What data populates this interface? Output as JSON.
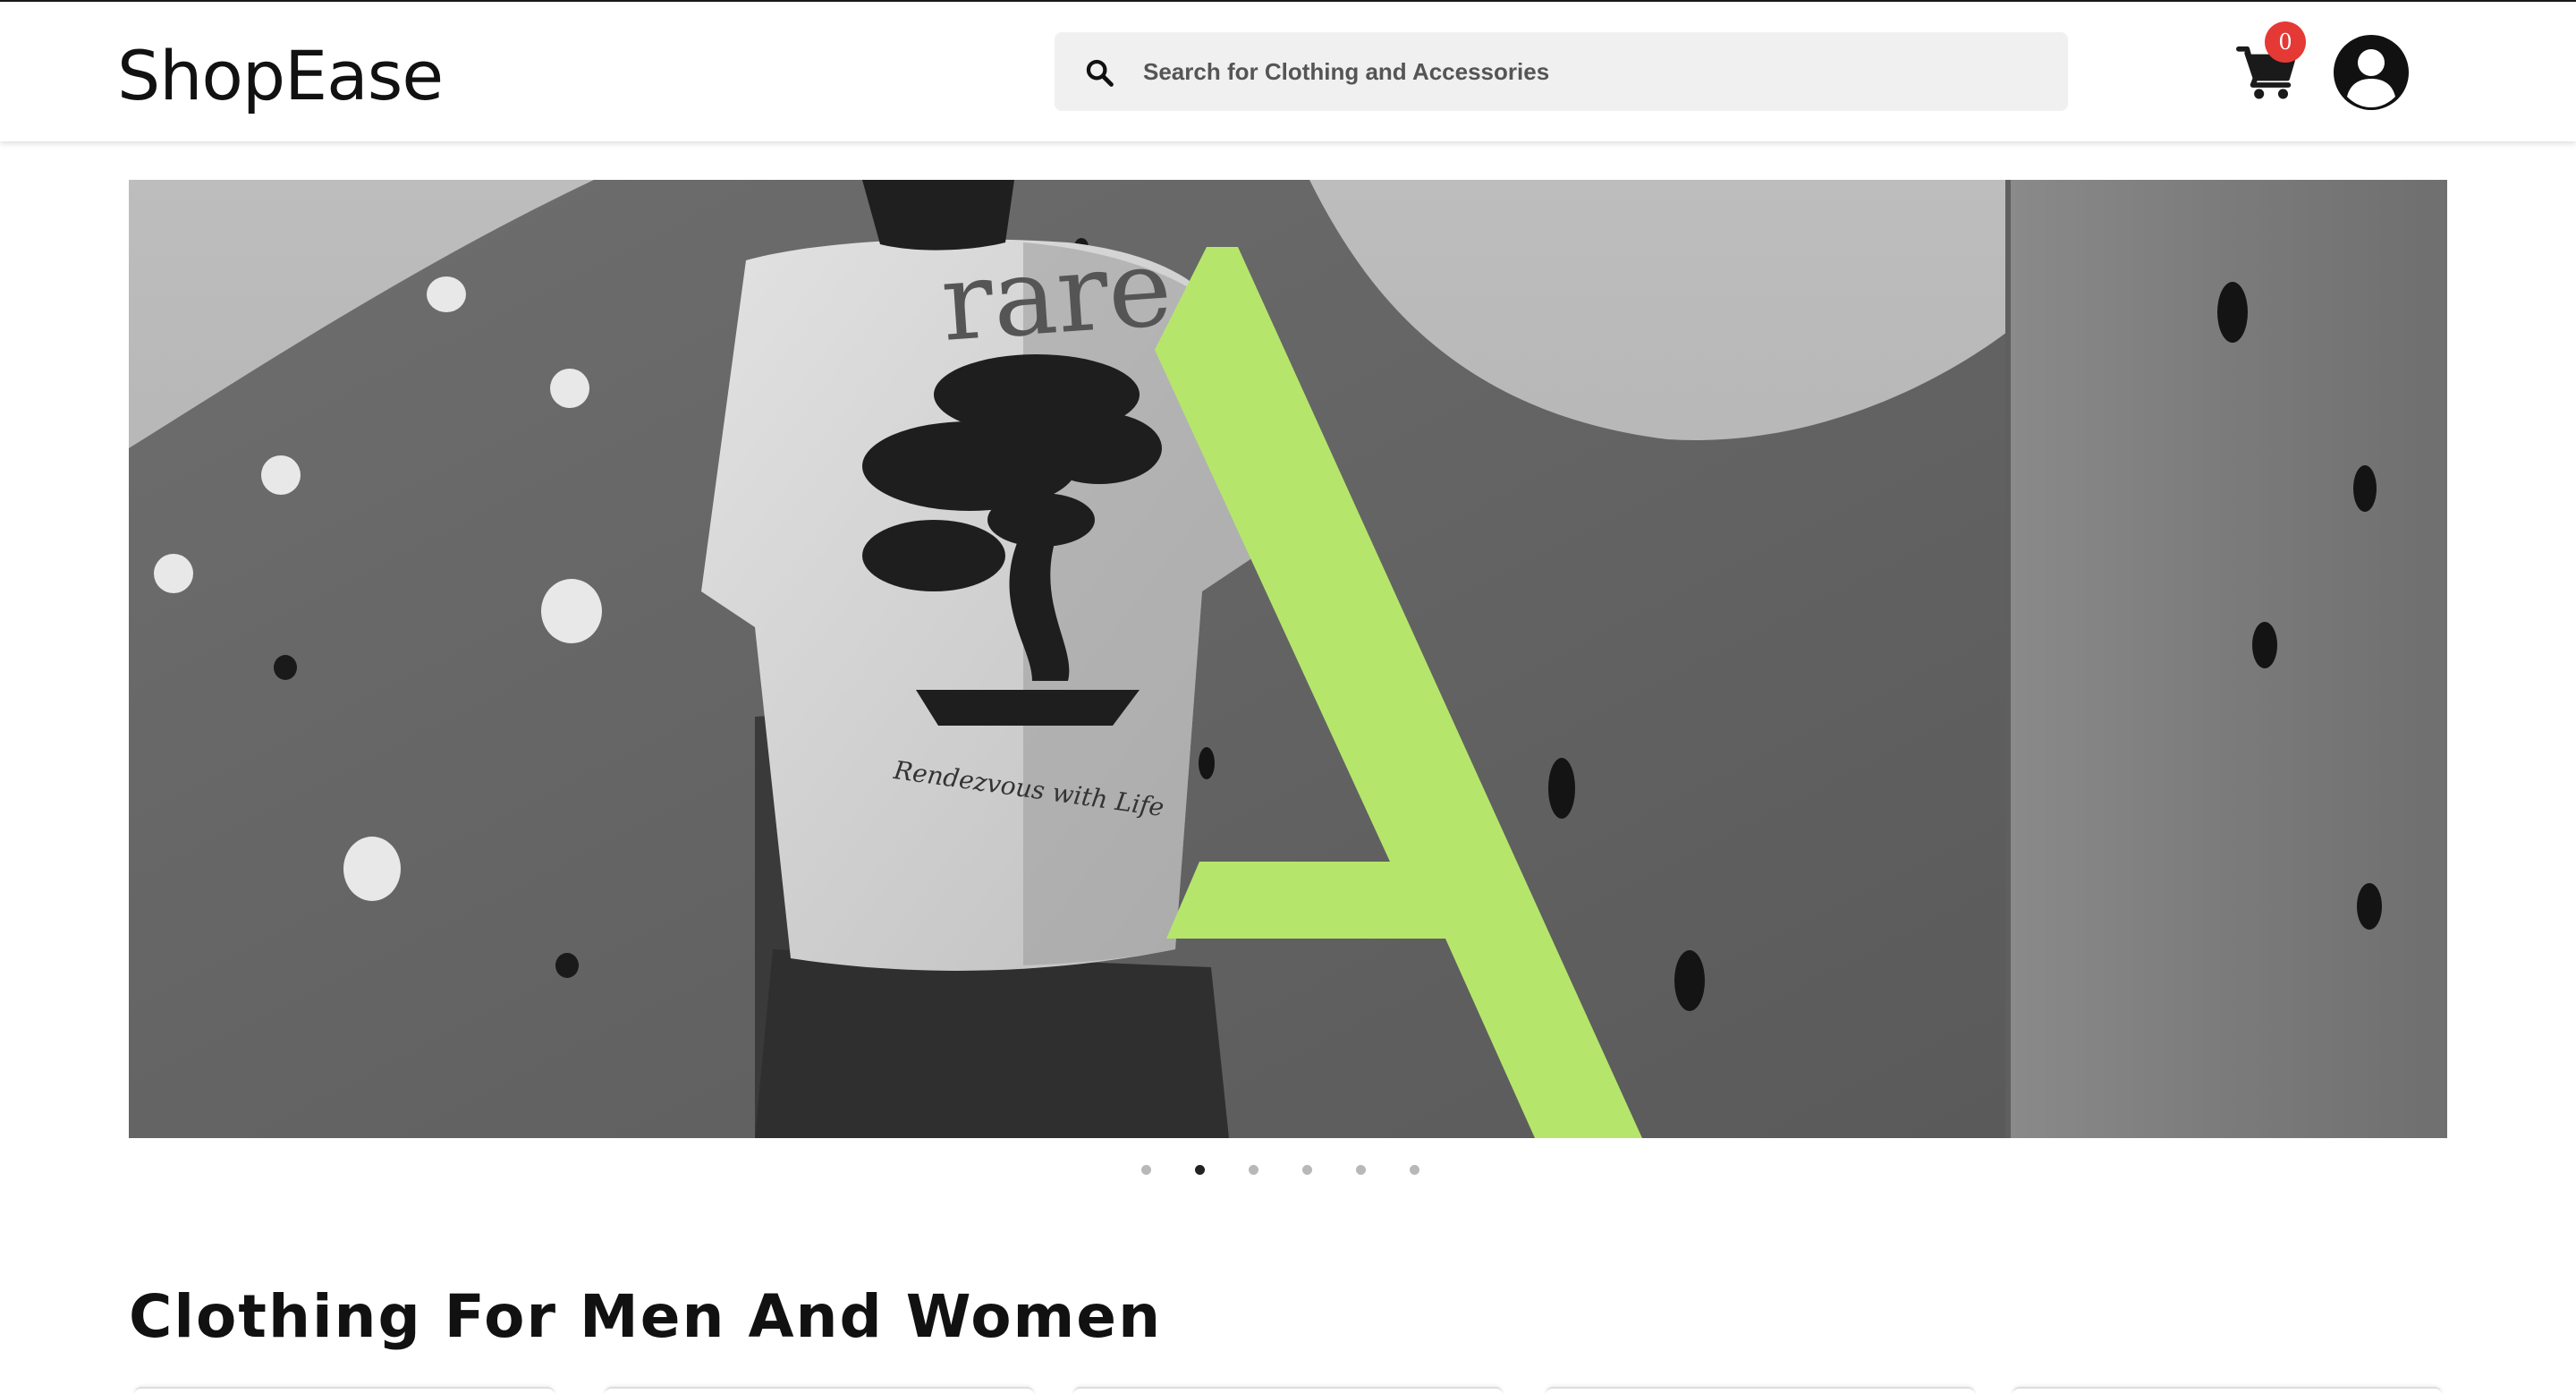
{
  "header": {
    "logo_text": "ShopEase",
    "search": {
      "placeholder": "Search for Clothing and Accessories",
      "icon": "search-icon"
    },
    "cart": {
      "icon": "cart-icon",
      "count": "0"
    },
    "account": {
      "icon": "user-account-icon"
    }
  },
  "hero": {
    "image": "banner-slide-tshirt",
    "tshirt_word": "rare",
    "tshirt_script": "Rendezvous with Life",
    "overlay_letter": "A",
    "accent_color": "#b5e66b",
    "slides_total": 6,
    "active_slide": 2
  },
  "section": {
    "title": "Clothing For Men And Women"
  },
  "colors": {
    "badge": "#e53935",
    "text": "#111111",
    "search_bg": "#f0f0f0"
  }
}
